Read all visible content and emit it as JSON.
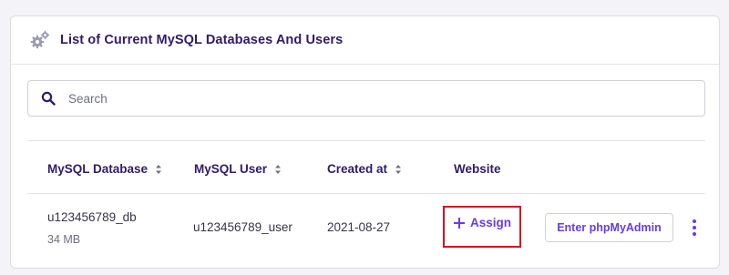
{
  "card": {
    "title": "List of Current MySQL Databases And Users",
    "header_icon": "gears-icon"
  },
  "search": {
    "placeholder": "Search",
    "value": "",
    "icon": "search-icon"
  },
  "table": {
    "columns": [
      {
        "label": "MySQL Database",
        "sortable": true
      },
      {
        "label": "MySQL User",
        "sortable": true
      },
      {
        "label": "Created at",
        "sortable": true
      },
      {
        "label": "Website",
        "sortable": false
      }
    ],
    "rows": [
      {
        "database": "u123456789_db",
        "size": "34 MB",
        "user": "u123456789_user",
        "created_at": "2021-08-27",
        "website_action": "Assign",
        "phpmyadmin_label": "Enter phpMyAdmin"
      }
    ]
  },
  "colors": {
    "accent": "#673de6",
    "title": "#2f1c6a",
    "highlight": "#d6131b"
  }
}
